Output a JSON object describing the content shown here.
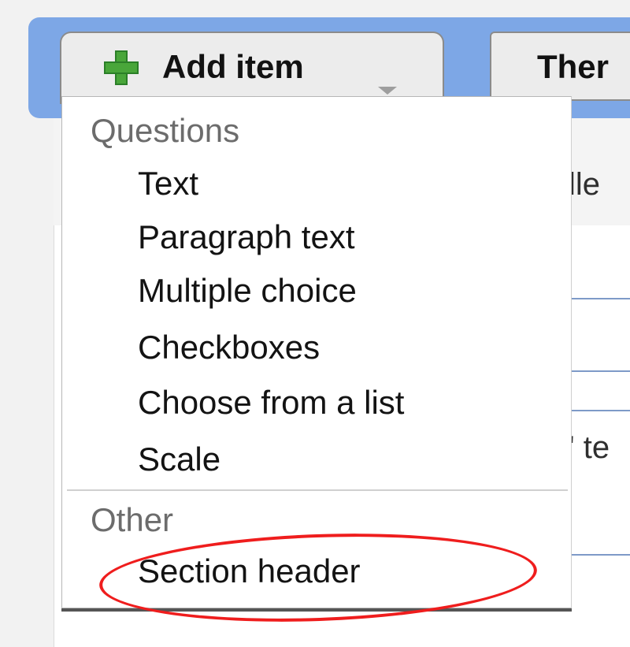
{
  "toolbar": {
    "add_item_label": "Add item",
    "theme_label": "Ther"
  },
  "dropdown": {
    "questions_heading": "Questions",
    "questions_items": [
      "Text",
      "Paragraph text",
      "Multiple choice",
      "Checkboxes",
      "Choose from a list",
      "Scale"
    ],
    "other_heading": "Other",
    "other_items": [
      "Section header"
    ]
  },
  "background": {
    "fragment_1": "lle",
    "fragment_2": "' te"
  },
  "icons": {
    "add": "plus-icon",
    "dropdown": "chevron-down-icon"
  },
  "colors": {
    "toolbar_band": "#7da7e6",
    "button_bg": "#ececec",
    "plus_green": "#49a63a",
    "highlight_red": "#ef1d1d"
  }
}
